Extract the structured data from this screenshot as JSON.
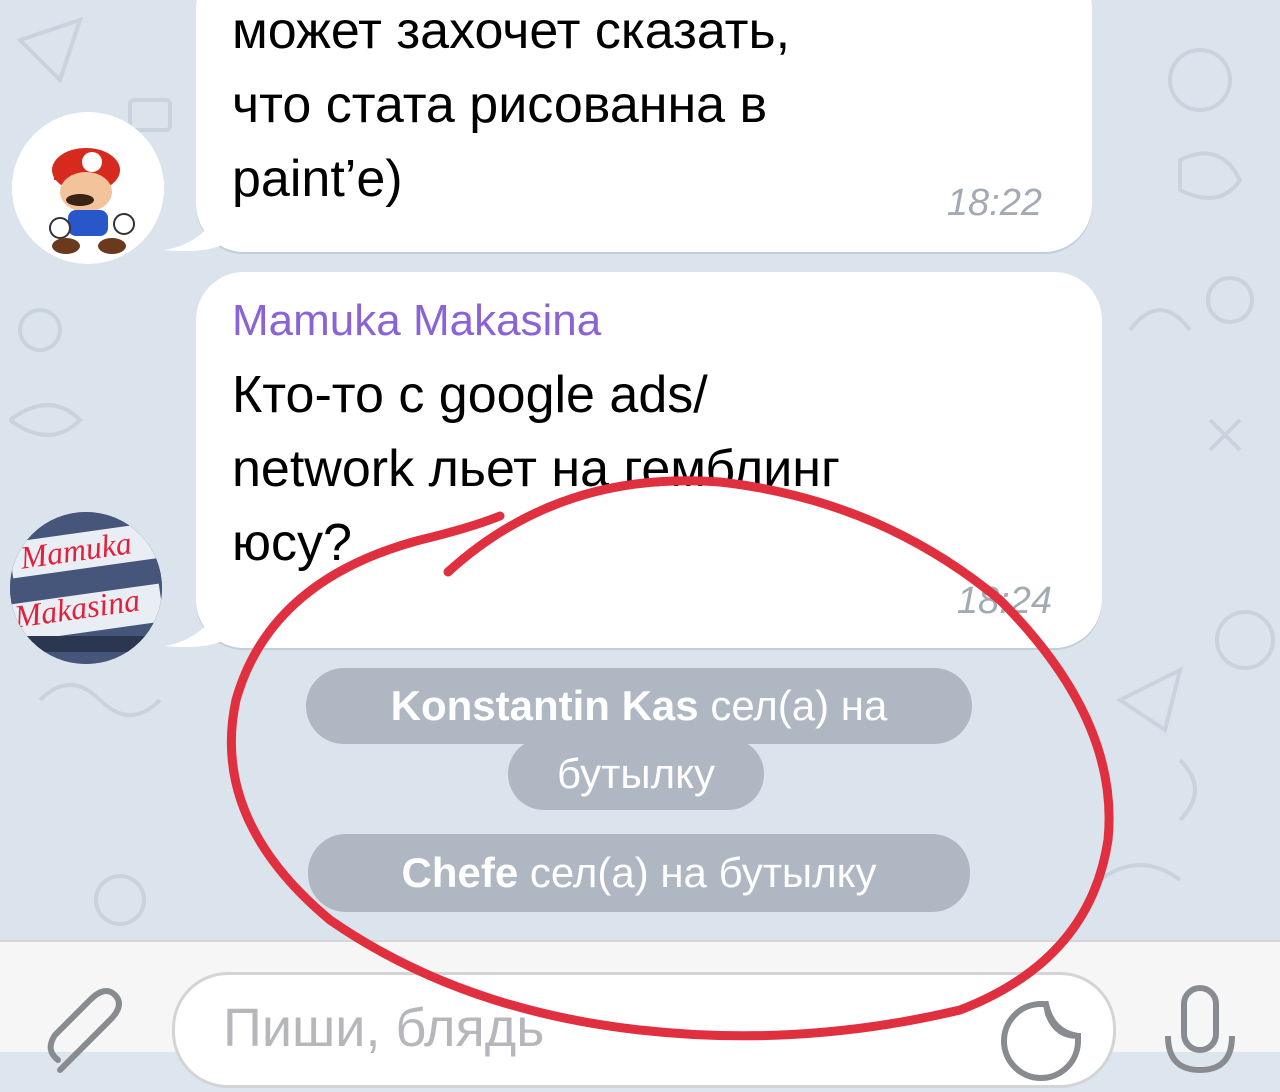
{
  "messages": [
    {
      "text": "может захочет сказать,\nчто стата рисованна в\npaint’e)",
      "time": "18:22"
    },
    {
      "sender": "Mamuka Makasina",
      "text": "Кто-то с google ads/\nnetwork льет на гемблинг\nюсу?",
      "time": "18:24"
    }
  ],
  "avatars": {
    "second_label_line1": "Mamuka",
    "second_label_line2": "Makasina"
  },
  "service_messages": [
    {
      "name": "Konstantin Kas",
      "action": "сел(а) на",
      "action2": "бутылку"
    },
    {
      "name": "Chefe",
      "action": "сел(а) на бутылку"
    }
  ],
  "input": {
    "placeholder": "Пиши, блядь"
  },
  "icons": [
    "paperclip-icon",
    "sticker-icon",
    "microphone-icon"
  ],
  "colors": {
    "sender": "#8a63d6",
    "annotation": "#e0303f",
    "service_bg": "#aeb7c2"
  }
}
